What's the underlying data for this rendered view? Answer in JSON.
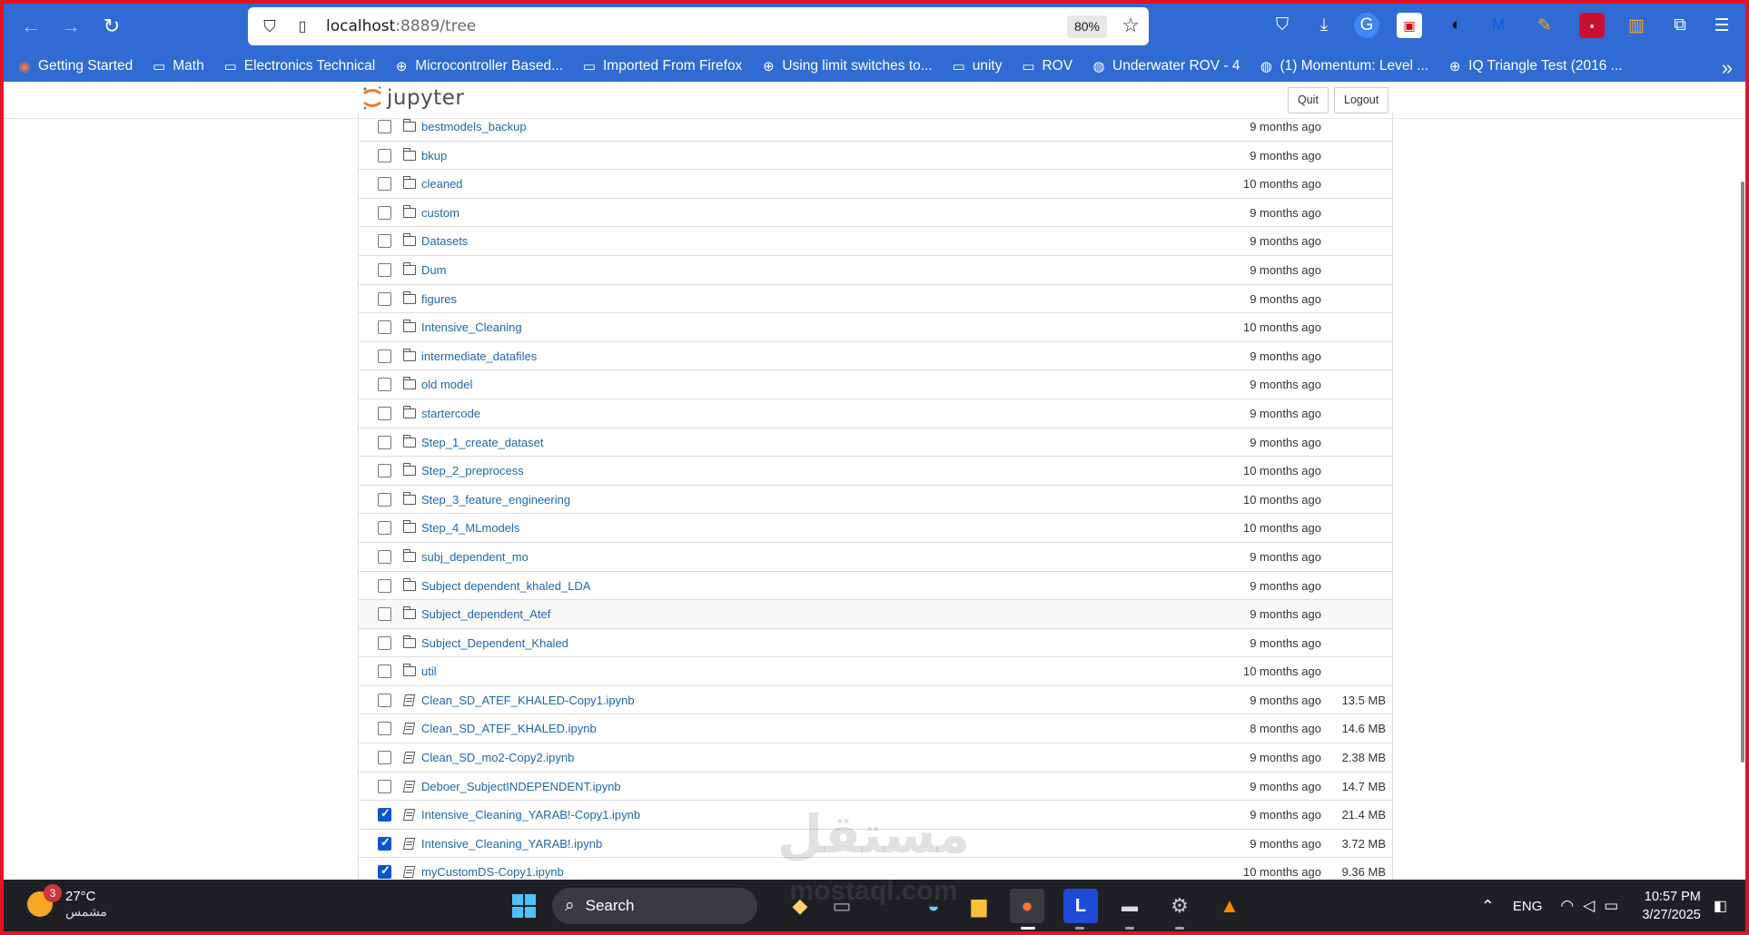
{
  "browser": {
    "url_host": "localhost",
    "url_path": ":8889/tree",
    "zoom": "80%",
    "bookmarks": [
      {
        "label": "Getting Started",
        "icon": "firefox-icon"
      },
      {
        "label": "Math",
        "icon": "folder-icon"
      },
      {
        "label": "Electronics Technical",
        "icon": "folder-icon"
      },
      {
        "label": "Microcontroller Based...",
        "icon": "globe-icon"
      },
      {
        "label": "Imported From Firefox",
        "icon": "folder-icon"
      },
      {
        "label": "Using limit switches to...",
        "icon": "globe-icon"
      },
      {
        "label": "unity",
        "icon": "folder-icon"
      },
      {
        "label": "ROV",
        "icon": "folder-icon"
      },
      {
        "label": "Underwater ROV - 4",
        "icon": "site-icon"
      },
      {
        "label": "(1) Momentum: Level ...",
        "icon": "site-icon"
      },
      {
        "label": "IQ Triangle Test (2016 ...",
        "icon": "globe-icon"
      }
    ]
  },
  "jupyter": {
    "logo_text": "jupyter",
    "quit_label": "Quit",
    "logout_label": "Logout"
  },
  "files": [
    {
      "name": "bestmodels_backup",
      "type": "folder",
      "modified": "9 months ago",
      "size": "",
      "checked": false
    },
    {
      "name": "bkup",
      "type": "folder",
      "modified": "9 months ago",
      "size": "",
      "checked": false
    },
    {
      "name": "cleaned",
      "type": "folder",
      "modified": "10 months ago",
      "size": "",
      "checked": false
    },
    {
      "name": "custom",
      "type": "folder",
      "modified": "9 months ago",
      "size": "",
      "checked": false
    },
    {
      "name": "Datasets",
      "type": "folder",
      "modified": "9 months ago",
      "size": "",
      "checked": false
    },
    {
      "name": "Dum",
      "type": "folder",
      "modified": "9 months ago",
      "size": "",
      "checked": false
    },
    {
      "name": "figures",
      "type": "folder",
      "modified": "9 months ago",
      "size": "",
      "checked": false
    },
    {
      "name": "Intensive_Cleaning",
      "type": "folder",
      "modified": "10 months ago",
      "size": "",
      "checked": false
    },
    {
      "name": "intermediate_datafiles",
      "type": "folder",
      "modified": "9 months ago",
      "size": "",
      "checked": false
    },
    {
      "name": "old model",
      "type": "folder",
      "modified": "9 months ago",
      "size": "",
      "checked": false
    },
    {
      "name": "startercode",
      "type": "folder",
      "modified": "9 months ago",
      "size": "",
      "checked": false
    },
    {
      "name": "Step_1_create_dataset",
      "type": "folder",
      "modified": "9 months ago",
      "size": "",
      "checked": false
    },
    {
      "name": "Step_2_preprocess",
      "type": "folder",
      "modified": "10 months ago",
      "size": "",
      "checked": false
    },
    {
      "name": "Step_3_feature_engineering",
      "type": "folder",
      "modified": "10 months ago",
      "size": "",
      "checked": false
    },
    {
      "name": "Step_4_MLmodels",
      "type": "folder",
      "modified": "10 months ago",
      "size": "",
      "checked": false
    },
    {
      "name": "subj_dependent_mo",
      "type": "folder",
      "modified": "9 months ago",
      "size": "",
      "checked": false
    },
    {
      "name": "Subject dependent_khaled_LDA",
      "type": "folder",
      "modified": "9 months ago",
      "size": "",
      "checked": false
    },
    {
      "name": "Subject_dependent_Atef",
      "type": "folder",
      "modified": "9 months ago",
      "size": "",
      "checked": false,
      "highlight": true
    },
    {
      "name": "Subject_Dependent_Khaled",
      "type": "folder",
      "modified": "9 months ago",
      "size": "",
      "checked": false
    },
    {
      "name": "util",
      "type": "folder",
      "modified": "10 months ago",
      "size": "",
      "checked": false
    },
    {
      "name": "Clean_SD_ATEF_KHALED-Copy1.ipynb",
      "type": "notebook",
      "modified": "9 months ago",
      "size": "13.5 MB",
      "checked": false
    },
    {
      "name": "Clean_SD_ATEF_KHALED.ipynb",
      "type": "notebook",
      "modified": "8 months ago",
      "size": "14.6 MB",
      "checked": false
    },
    {
      "name": "Clean_SD_mo2-Copy2.ipynb",
      "type": "notebook",
      "modified": "9 months ago",
      "size": "2.38 MB",
      "checked": false
    },
    {
      "name": "Deboer_SubjectINDEPENDENT.ipynb",
      "type": "notebook",
      "modified": "9 months ago",
      "size": "14.7 MB",
      "checked": false
    },
    {
      "name": "Intensive_Cleaning_YARAB!-Copy1.ipynb",
      "type": "notebook",
      "modified": "9 months ago",
      "size": "21.4 MB",
      "checked": true
    },
    {
      "name": "Intensive_Cleaning_YARAB!.ipynb",
      "type": "notebook",
      "modified": "9 months ago",
      "size": "3.72 MB",
      "checked": true
    },
    {
      "name": "myCustomDS-Copy1.ipynb",
      "type": "notebook",
      "modified": "10 months ago",
      "size": "9.36 MB",
      "checked": true
    }
  ],
  "watermark": {
    "arabic": "مستقل",
    "latin": "mostaql.com"
  },
  "taskbar": {
    "weather_temp": "27°C",
    "weather_cond": "مشمس",
    "weather_badge": "3",
    "search_label": "Search",
    "lang": "ENG",
    "time": "10:57 PM",
    "date": "3/27/2025"
  },
  "colors": {
    "chrome": "#2f6bd2",
    "link": "#2266aa",
    "frame": "#e81123",
    "taskbar": "#1f2024"
  }
}
